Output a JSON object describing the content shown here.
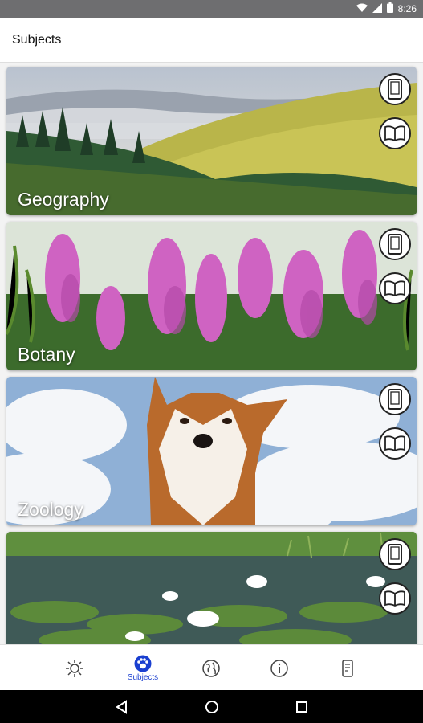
{
  "status_bar": {
    "time": "8:26",
    "icons": [
      "wifi-icon",
      "signal-icon",
      "battery-icon"
    ]
  },
  "app_bar": {
    "title": "Subjects"
  },
  "cards": [
    {
      "label": "Geography",
      "top_button_icon": "phone-icon",
      "bottom_button_icon": "book-icon"
    },
    {
      "label": "Botany",
      "top_button_icon": "phone-icon",
      "bottom_button_icon": "book-icon"
    },
    {
      "label": "Zoology",
      "top_button_icon": "phone-icon",
      "bottom_button_icon": "book-icon"
    },
    {
      "label": "",
      "top_button_icon": "phone-icon",
      "bottom_button_icon": "book-icon"
    }
  ],
  "bottom_nav": {
    "items": [
      {
        "icon": "sun-icon",
        "label": ""
      },
      {
        "icon": "paw-icon",
        "label": "Subjects",
        "active": true
      },
      {
        "icon": "globe-icon",
        "label": ""
      },
      {
        "icon": "info-icon",
        "label": ""
      },
      {
        "icon": "device-icon",
        "label": ""
      }
    ]
  },
  "system_nav": {
    "icons": [
      "back-icon",
      "home-icon",
      "recents-icon"
    ]
  },
  "colors": {
    "accent": "#1a3fd0",
    "status_bar": "#6e6e70"
  }
}
